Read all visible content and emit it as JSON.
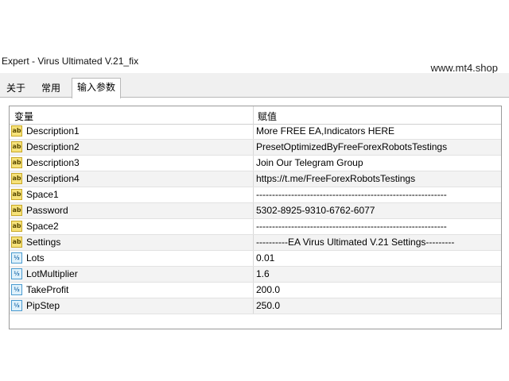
{
  "window": {
    "title": "Expert - Virus Ultimated V.21_fix",
    "watermark": "www.mt4.shop"
  },
  "tabs": [
    {
      "label": "关于",
      "active": false
    },
    {
      "label": "常用",
      "active": false
    },
    {
      "label": "输入参数",
      "active": true
    }
  ],
  "grid": {
    "headers": {
      "variable": "变量",
      "value": "赋值"
    },
    "rows": [
      {
        "type": "ab",
        "name": "Description1",
        "value": "More FREE EA,Indicators HERE"
      },
      {
        "type": "ab",
        "name": "Description2",
        "value": "PresetOptimizedByFreeForexRobotsTestings"
      },
      {
        "type": "ab",
        "name": "Description3",
        "value": "Join Our Telegram Group"
      },
      {
        "type": "ab",
        "name": "Description4",
        "value": "https://t.me/FreeForexRobotsTestings"
      },
      {
        "type": "ab",
        "name": "Space1",
        "value": "------------------------------------------------------------"
      },
      {
        "type": "ab",
        "name": "Password",
        "value": "5302-8925-9310-6762-6077"
      },
      {
        "type": "ab",
        "name": "Space2",
        "value": "------------------------------------------------------------"
      },
      {
        "type": "ab",
        "name": "Settings",
        "value": "----------EA Virus Ultimated V.21 Settings---------"
      },
      {
        "type": "num",
        "name": "Lots",
        "value": "0.01"
      },
      {
        "type": "num",
        "name": "LotMultiplier",
        "value": "1.6"
      },
      {
        "type": "num",
        "name": "TakeProfit",
        "value": "200.0"
      },
      {
        "type": "num",
        "name": "PipStep",
        "value": "250.0"
      }
    ]
  },
  "icons": {
    "ab": "string-type-icon",
    "num": "number-type-icon"
  }
}
